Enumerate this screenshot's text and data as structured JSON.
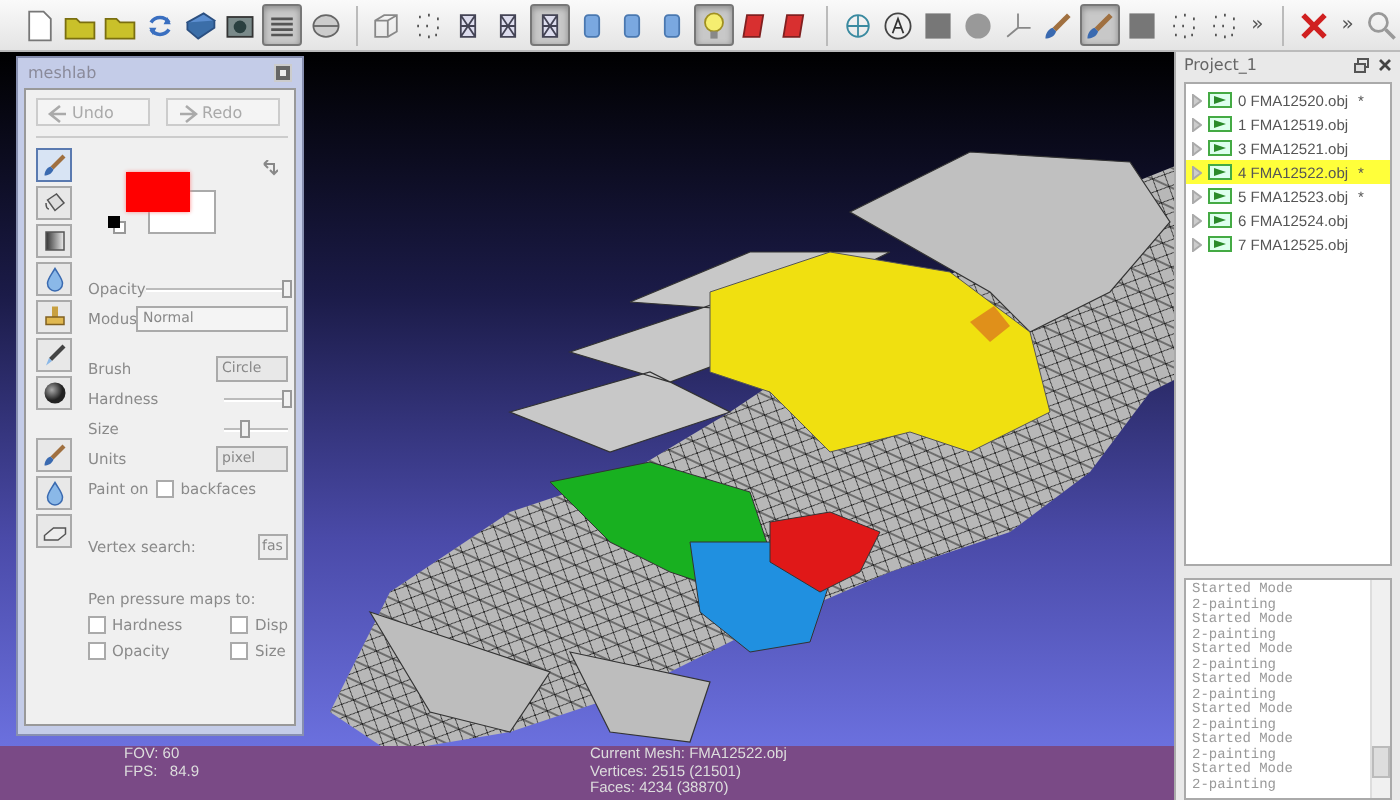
{
  "toolbar": [
    {
      "kind": "new-file",
      "pressed": false
    },
    {
      "kind": "folder",
      "pressed": false
    },
    {
      "kind": "folder",
      "pressed": false
    },
    {
      "kind": "reload",
      "pressed": false
    },
    {
      "kind": "save",
      "pressed": false
    },
    {
      "kind": "camera",
      "pressed": false
    },
    {
      "kind": "layers",
      "pressed": true
    },
    {
      "kind": "disc",
      "pressed": false
    }
  ],
  "toolbar_view": [
    {
      "kind": "cube",
      "pressed": false
    },
    {
      "kind": "points",
      "pressed": false
    },
    {
      "kind": "wire",
      "pressed": false
    },
    {
      "kind": "wire",
      "pressed": false
    },
    {
      "kind": "wire",
      "pressed": true
    },
    {
      "kind": "cylinder",
      "pressed": false
    },
    {
      "kind": "cylinder",
      "pressed": false
    },
    {
      "kind": "cylinder",
      "pressed": false
    },
    {
      "kind": "light",
      "pressed": true
    },
    {
      "kind": "texture",
      "pressed": false
    },
    {
      "kind": "texture",
      "pressed": false
    }
  ],
  "toolbar_edit": [
    {
      "kind": "globe",
      "pressed": false
    },
    {
      "kind": "ring",
      "pressed": false
    },
    {
      "kind": "square",
      "pressed": false
    },
    {
      "kind": "blob",
      "pressed": false
    },
    {
      "kind": "axes",
      "pressed": false
    },
    {
      "kind": "brush",
      "pressed": false
    },
    {
      "kind": "brush",
      "pressed": true
    },
    {
      "kind": "square",
      "pressed": false
    },
    {
      "kind": "points",
      "pressed": false
    },
    {
      "kind": "points",
      "pressed": false
    }
  ],
  "toolbar_more": "»",
  "toolbar_end": [
    {
      "kind": "cross",
      "pressed": false
    }
  ],
  "toolbar_more_2": "»",
  "toolbar_search": {
    "kind": "search",
    "pressed": false
  },
  "paint_dialog": {
    "title": "meshlab",
    "undo": "Undo",
    "redo": "Redo",
    "tools": [
      {
        "kind": "brush",
        "selected": true
      },
      {
        "kind": "bucket",
        "selected": false
      },
      {
        "kind": "gradient",
        "selected": false
      },
      {
        "kind": "drop",
        "selected": false
      },
      {
        "kind": "stamp",
        "selected": false
      },
      {
        "kind": "picker",
        "selected": false
      },
      {
        "kind": "sphere",
        "selected": false
      }
    ],
    "tools_lower": [
      {
        "kind": "brush",
        "selected": false
      },
      {
        "kind": "drop",
        "selected": false
      },
      {
        "kind": "eraser",
        "selected": false
      }
    ],
    "opacity": {
      "label": "Opacity",
      "level": 1
    },
    "modus": {
      "label": "Modus",
      "value": "Normal"
    },
    "brush": {
      "label": "Brush",
      "value": "Circle"
    },
    "hardness": {
      "label": "Hardness",
      "level": 1
    },
    "size": {
      "label": "Size",
      "level": 0.35
    },
    "units": {
      "label": "Units",
      "value": "pixel"
    },
    "paint_on": {
      "label": "Paint on",
      "option": "backfaces",
      "checked": false
    },
    "vertex_search": {
      "label": "Vertex search:",
      "value": "fas"
    },
    "pen_pressure": {
      "label": "Pen pressure maps to:",
      "options": [
        {
          "label": "Hardness",
          "checked": false
        },
        {
          "label": "Disp",
          "checked": false
        },
        {
          "label": "Opacity",
          "checked": false
        },
        {
          "label": "Size",
          "checked": false
        }
      ]
    }
  },
  "viewport": {
    "info_left": [
      "FOV: 60",
      "FPS:   84.9"
    ],
    "info_center": [
      "Current Mesh: FMA12522.obj",
      "Vertices: 2515 (21501)",
      "Faces: 4234 (38870)"
    ]
  },
  "project_panel": {
    "title": "Project_1",
    "layers": [
      {
        "label": "0 FMA12520.obj",
        "flag": "*",
        "selected": false
      },
      {
        "label": "1 FMA12519.obj",
        "selected": false
      },
      {
        "label": "3 FMA12521.obj",
        "selected": false
      },
      {
        "label": "4 FMA12522.obj",
        "flag": "*",
        "selected": true
      },
      {
        "label": "5 FMA12523.obj",
        "flag": "*",
        "selected": false
      },
      {
        "label": "6 FMA12524.obj",
        "selected": false
      },
      {
        "label": "7 FMA12525.obj",
        "selected": false
      }
    ]
  },
  "log": {
    "entries": [
      "Started Mode 2-painting",
      "Started Mode 2-painting",
      "Started Mode 2-painting",
      "Started Mode 2-painting",
      "Started Mode 2-painting",
      "Started Mode 2-painting",
      "Started Mode 2-painting"
    ]
  }
}
